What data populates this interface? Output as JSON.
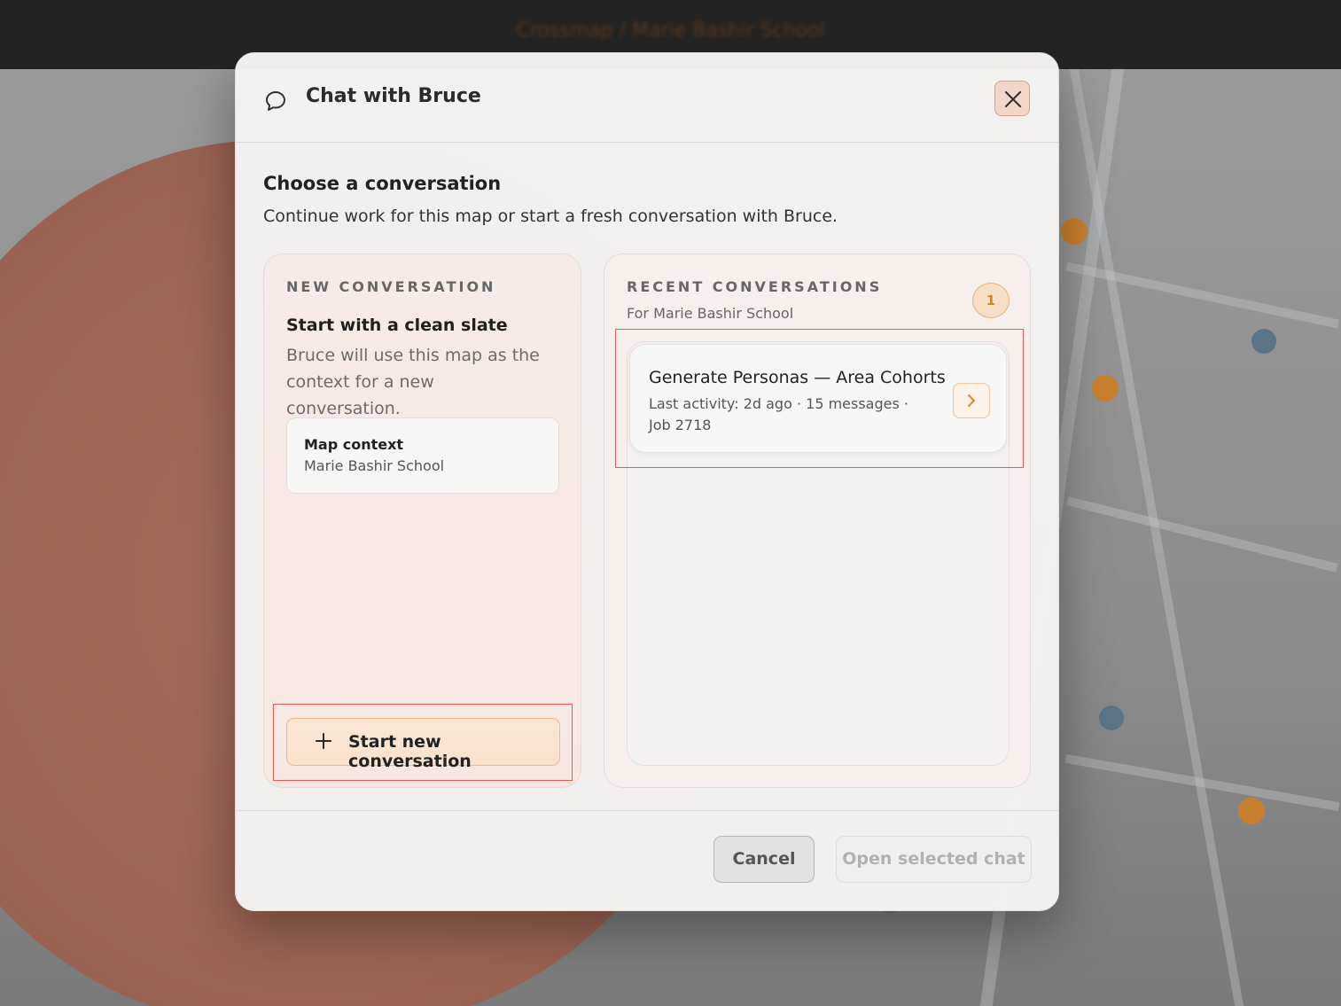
{
  "background": {
    "topbar_title": "Crossmap / Marie Bashir School"
  },
  "dialog": {
    "title": "Chat with Bruce",
    "icon": "chat-bubble-icon",
    "close_icon": "close-icon",
    "heading": "Choose a conversation",
    "description": "Continue work for this map or start a fresh conversation with Bruce."
  },
  "new_conversation": {
    "kicker": "NEW CONVERSATION",
    "title": "Start with a clean slate",
    "description": "Bruce will use this map as the context for a new conversation.",
    "context_label": "Map context",
    "context_value": "Marie Bashir School",
    "start_button_icon": "plus-icon",
    "start_button_label": "Start new conversation"
  },
  "recent": {
    "kicker": "RECENT CONVERSATIONS",
    "subtitle": "For Marie Bashir School",
    "count": "1",
    "items": [
      {
        "title": "Generate Personas — Area Cohorts",
        "meta": "Last activity: 2d ago · 15 messages · Job 2718",
        "action_icon": "chevron-right-icon"
      }
    ]
  },
  "footer": {
    "cancel_label": "Cancel",
    "open_label": "Open selected chat"
  },
  "colors": {
    "accent": "#f0b787",
    "badge_text": "#d98424",
    "highlight": "#e15b5b"
  }
}
